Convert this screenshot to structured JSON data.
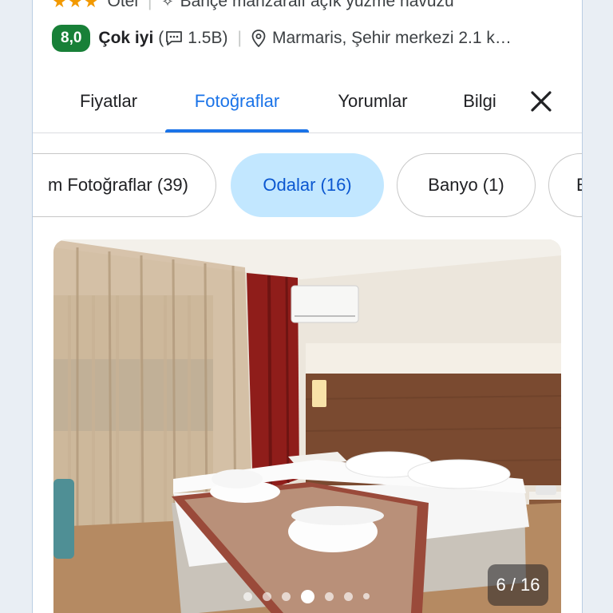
{
  "hotel": {
    "type": "Otel",
    "stars": "★★★",
    "feature": "Bahçe manzaralı açık yüzme havuzu",
    "rating_score": "8,0",
    "rating_label": "Çok iyi",
    "review_open": "(",
    "review_count": "1.5B)",
    "location": "Marmaris, Şehir merkezi 2.1 k…"
  },
  "tabs": [
    {
      "label": "Fiyatlar"
    },
    {
      "label": "Fotoğraflar"
    },
    {
      "label": "Yorumlar"
    },
    {
      "label": "Bilgi"
    }
  ],
  "active_tab": "Fotoğraflar",
  "chips": [
    {
      "label": "m Fotoğraflar (39)"
    },
    {
      "label": "Odalar (16)"
    },
    {
      "label": "Banyo (1)"
    },
    {
      "label": "E"
    }
  ],
  "active_chip": "Odalar (16)",
  "photo": {
    "counter": "6 / 16",
    "current_index": 6,
    "total": 16
  },
  "colors": {
    "accent": "#1a73e8",
    "rating_badge": "#188038",
    "star": "#f29900",
    "active_chip_bg": "#c2e7ff"
  },
  "icons": [
    "star-icon",
    "sparkle-icon",
    "chat-icon",
    "location-pin-icon",
    "close-icon"
  ]
}
